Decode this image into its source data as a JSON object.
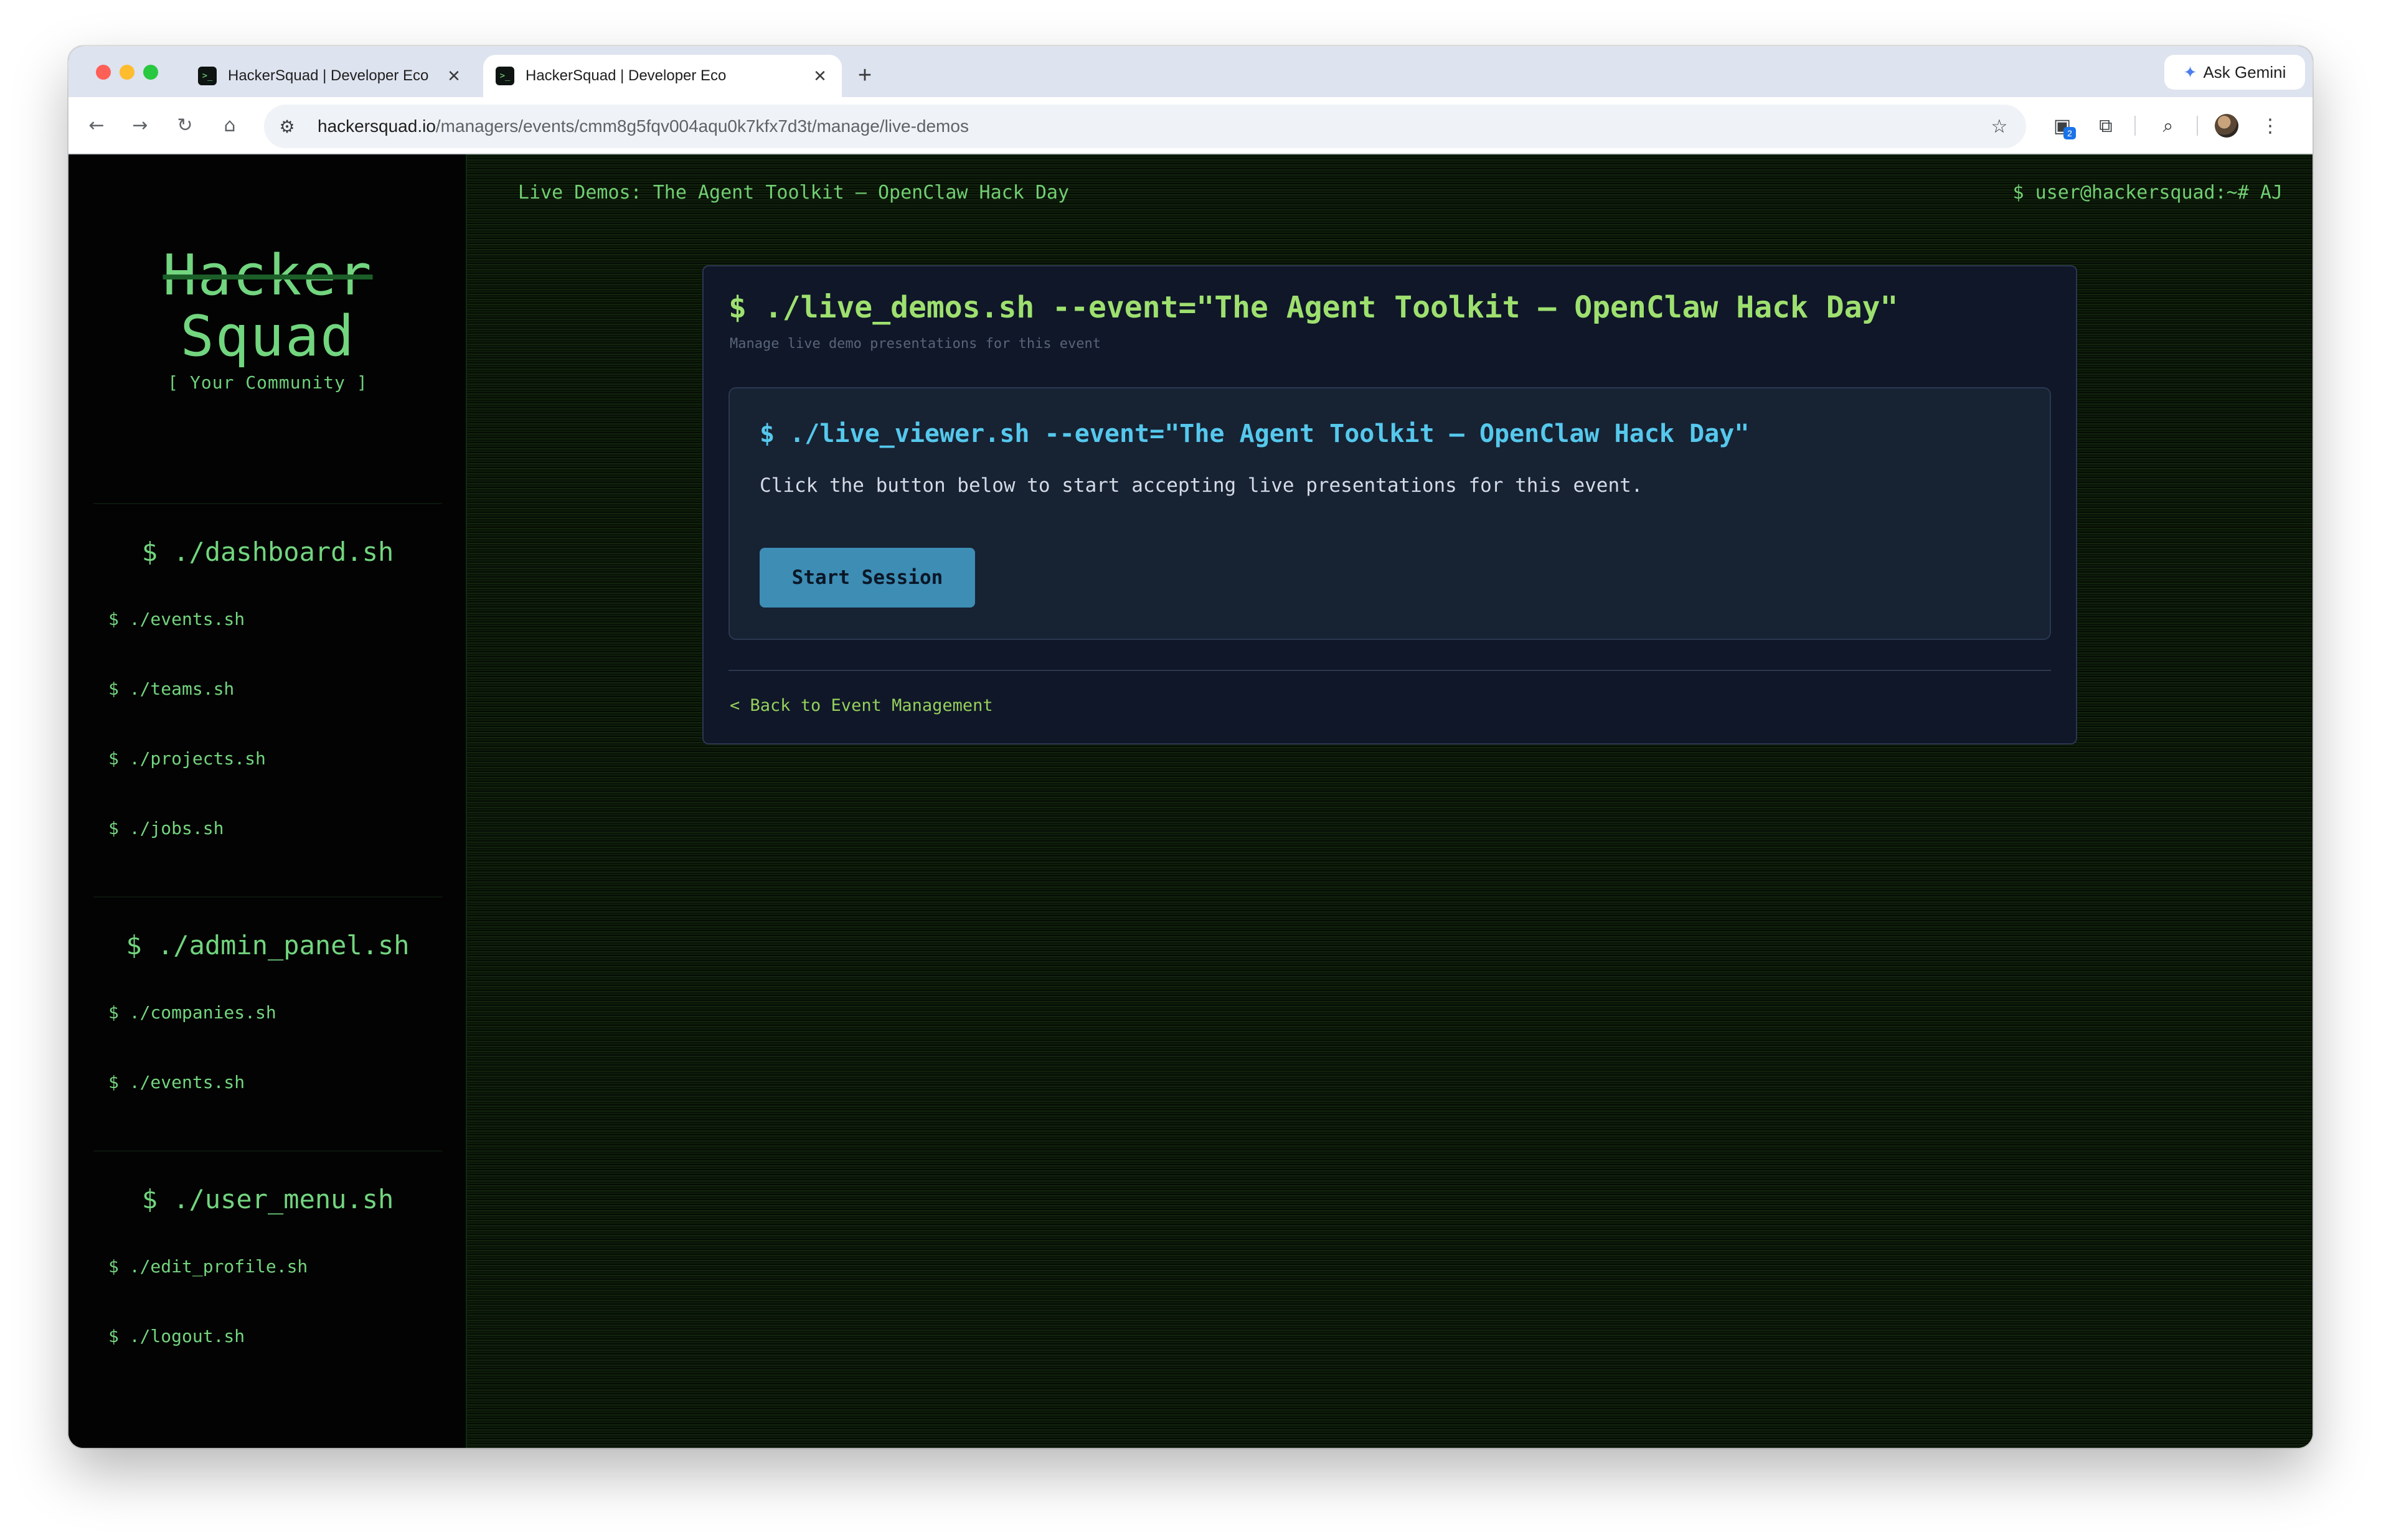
{
  "browser": {
    "tabs": [
      {
        "title": "HackerSquad | Developer Eco",
        "favicon": ">_",
        "active": false
      },
      {
        "title": "HackerSquad | Developer Eco",
        "favicon": ">_",
        "active": true
      }
    ],
    "new_tab": "+",
    "close_glyph": "✕",
    "ask_gemini": "Ask Gemini",
    "url_host": "hackersquad.io",
    "url_path": "/managers/events/cmm8g5fqv004aqu0k7kfx7d3t/manage/live-demos",
    "extension_badge": "2"
  },
  "sidebar": {
    "logo_line1": "Hacker",
    "logo_line2": "Squad",
    "tagline": "[ Your Community ]",
    "sections": [
      {
        "title": "$ ./dashboard.sh",
        "items": [
          "$ ./events.sh",
          "$ ./teams.sh",
          "$ ./projects.sh",
          "$ ./jobs.sh"
        ]
      },
      {
        "title": "$ ./admin_panel.sh",
        "items": [
          "$ ./companies.sh",
          "$ ./events.sh"
        ]
      },
      {
        "title": "$ ./user_menu.sh",
        "items": [
          "$ ./edit_profile.sh",
          "$ ./logout.sh"
        ]
      }
    ]
  },
  "header": {
    "page_title": "Live Demos: The Agent Toolkit – OpenClaw Hack Day",
    "user_prompt": "$ user@hackersquad:~# AJ"
  },
  "card": {
    "title": "$ ./live_demos.sh --event=\"The Agent Toolkit – OpenClaw Hack Day\"",
    "subtitle": "Manage live demo presentations for this event",
    "viewer": {
      "title": "$ ./live_viewer.sh --event=\"The Agent Toolkit – OpenClaw Hack Day\"",
      "text": "Click the button below to start accepting live presentations for this event.",
      "button": "Start Session"
    },
    "back_link": "< Back to Event Management"
  },
  "colors": {
    "terminal_green": "#72d57f",
    "title_green": "#9ee06f",
    "viewer_cyan": "#55c8ec",
    "button_blue": "#3d8db4",
    "card_bg": "#0f1728"
  },
  "icons": [
    "back-arrow-icon",
    "forward-arrow-icon",
    "reload-icon",
    "home-icon",
    "site-settings-icon",
    "bookmark-star-icon",
    "extension-icon",
    "puzzle-icon",
    "search-tab-icon",
    "profile-avatar-icon",
    "more-menu-icon",
    "gemini-spark-icon"
  ]
}
